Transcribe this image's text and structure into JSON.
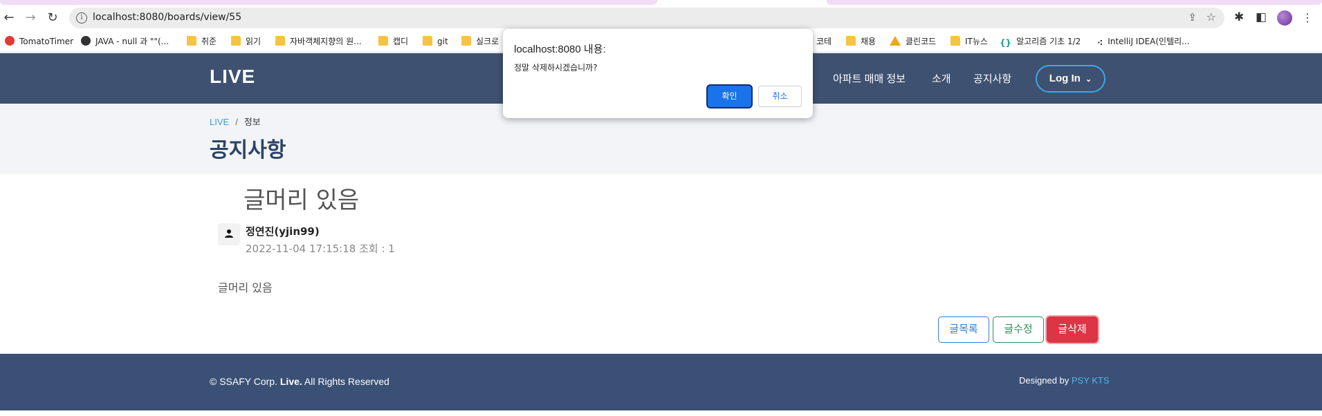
{
  "browser": {
    "url": "localhost:8080/boards/view/55",
    "bookmarks": [
      {
        "label": "TomatoTimer",
        "icon": "tomato-icon"
      },
      {
        "label": "JAVA - null 과 \"\"(...",
        "icon": "globe-icon"
      },
      {
        "label": "취준",
        "icon": "folder-icon"
      },
      {
        "label": "읽기",
        "icon": "folder-icon"
      },
      {
        "label": "자바객체지향의 원...",
        "icon": "folder-icon"
      },
      {
        "label": "캡디",
        "icon": "folder-icon"
      },
      {
        "label": "git",
        "icon": "folder-icon"
      },
      {
        "label": "실크로",
        "icon": "folder-icon"
      },
      {
        "label": "코테",
        "icon": "folder-icon"
      },
      {
        "label": "채용",
        "icon": "folder-icon"
      },
      {
        "label": "클린코드",
        "icon": "warning-icon"
      },
      {
        "label": "IT뉴스",
        "icon": "folder-icon"
      },
      {
        "label": "알고리즘 기초 1/2",
        "icon": "code-icon"
      },
      {
        "label": "IntelliJ IDEA(인텔리...",
        "icon": "dots-icon"
      }
    ]
  },
  "site": {
    "logo": "LIVE",
    "nav": [
      "아파트 매매 정보",
      "소개",
      "공지사항"
    ],
    "login": "Log In",
    "breadcrumb": {
      "home": "LIVE",
      "sep": "/",
      "current": "정보"
    },
    "page_title": "공지사항"
  },
  "article": {
    "title": "글머리 있음",
    "author": "정연진(yjin99)",
    "meta": "2022-11-04 17:15:18 조회 : 1",
    "body": "글머리 있음"
  },
  "buttons": {
    "list": "글목록",
    "edit": "글수정",
    "delete": "글삭제"
  },
  "footer": {
    "copyright_prefix": "© SSAFY Corp. ",
    "copyright_brand": "Live.",
    "copyright_suffix": " All Rights Reserved",
    "designed_prefix": "Designed by ",
    "designed_link": "PSY KTS"
  },
  "dialog": {
    "title": "localhost:8080 내용:",
    "message": "정말 삭제하시겠습니까?",
    "ok": "확인",
    "cancel": "취소"
  },
  "colors": {
    "header_bg": "#3e5170",
    "footer_bg": "#3a5175",
    "accent_blue": "#1a73e8",
    "danger": "#dc3545"
  }
}
